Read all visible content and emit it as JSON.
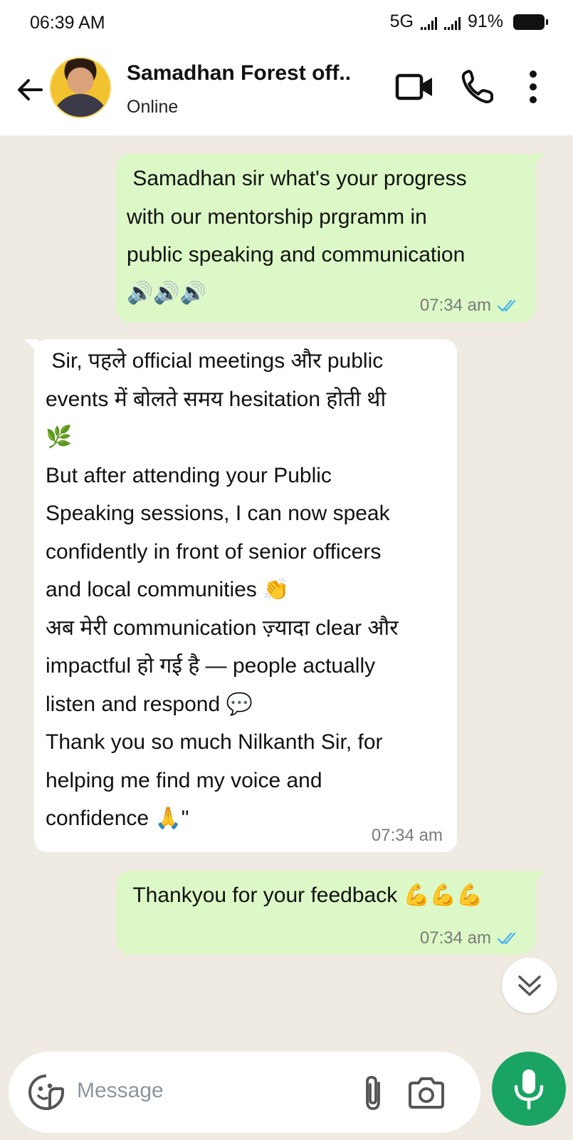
{
  "status_bar": {
    "time": "06:39 AM",
    "network": "5G",
    "battery": "91%"
  },
  "header": {
    "contact_name": "Samadhan Forest off..",
    "contact_status": "Online",
    "icons": [
      "back-arrow-icon",
      "video-call-icon",
      "voice-call-icon",
      "more-options-icon"
    ]
  },
  "messages": [
    {
      "direction": "outgoing",
      "text": " Samadhan sir what's your progress\nwith our mentorship prgramm in\npublic speaking and communication\n🔊🔊🔊",
      "time": "07:34 am",
      "read": true
    },
    {
      "direction": "incoming",
      "text": " Sir, पहले official meetings और public\nevents में बोलते समय hesitation होती थी\n🌿\nBut after attending your Public\nSpeaking sessions, I can now speak\nconfidently in front of senior officers\nand local communities 👏\nअब मेरी communication ज़्यादा clear और\nimpactful हो गई है — people actually\nlisten and respond 💬\nThank you so much Nilkanth Sir, for\nhelping me find my voice and\nconfidence 🙏\"",
      "time": "07:34 am"
    },
    {
      "direction": "outgoing",
      "text": " Thankyou for your feedback 💪💪💪",
      "time": "07:34 am",
      "read": true
    }
  ],
  "composer": {
    "placeholder": "Message",
    "icons": [
      "sticker-icon",
      "attach-icon",
      "camera-icon",
      "mic-icon"
    ]
  },
  "colors": {
    "outgoing_bubble": "#dcf8c6",
    "incoming_bubble": "#ffffff",
    "chat_background": "#efeae2",
    "read_ticks": "#4fb6ec",
    "mic_button": "#1aa463"
  }
}
